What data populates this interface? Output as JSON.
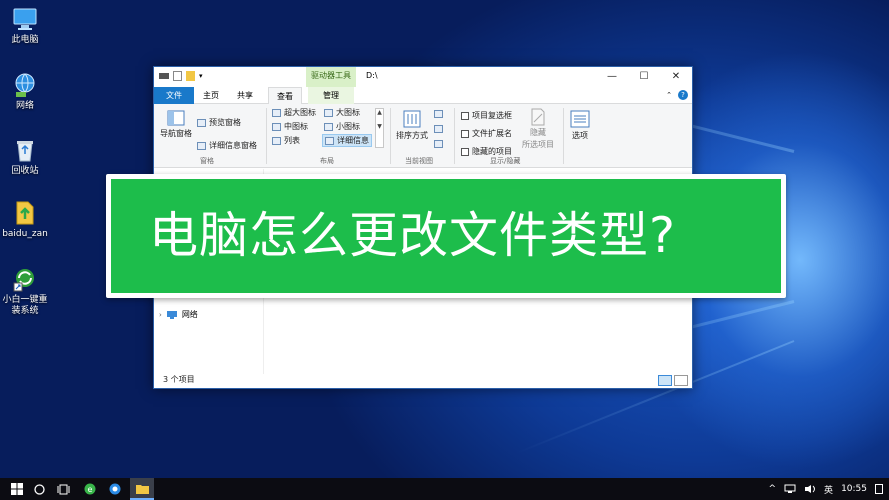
{
  "desktop_icons": [
    {
      "label": "此电脑",
      "icon": "this-pc-icon"
    },
    {
      "label": "网络",
      "icon": "network-icon"
    },
    {
      "label": "回收站",
      "icon": "recycle-bin-icon"
    },
    {
      "label": "baidu_zan",
      "icon": "file-icon"
    },
    {
      "label": "小白一键重装系统",
      "icon": "app-shortcut-icon"
    }
  ],
  "explorer": {
    "context_tab": "驱动器工具",
    "title": "D:\\",
    "tabs": [
      "文件",
      "主页",
      "共享",
      "查看",
      "管理"
    ],
    "ribbon": {
      "nav_pane": "导航窗格",
      "preview_pane": "预览窗格",
      "details_pane": "详细信息窗格",
      "pane_group": "窗格",
      "layout_items": [
        "超大图标",
        "大图标",
        "中图标",
        "小图标",
        "列表",
        "详细信息"
      ],
      "layout_group": "布局",
      "sort_by": "排序方式",
      "current_view_group": "当前视图",
      "checkboxes": [
        "项目复选框",
        "文件扩展名",
        "隐藏的项目"
      ],
      "hide_selected": "隐藏",
      "hide_selected_2": "所选项目",
      "show_hide_group": "显示/隐藏",
      "options": "选项"
    },
    "nav_network": "网络",
    "status": "3 个项目"
  },
  "banner": {
    "text": "电脑怎么更改文件类型?"
  },
  "taskbar": {
    "lang": "英",
    "time": "10:55"
  }
}
